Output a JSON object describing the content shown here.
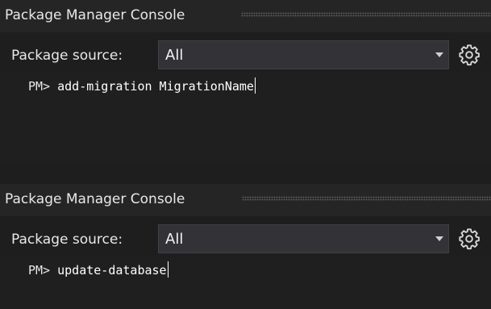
{
  "panels": [
    {
      "title": "Package Manager Console",
      "source_label": "Package source:",
      "source_value": "All",
      "prompt": "PM>",
      "command": "add-migration MigrationName"
    },
    {
      "title": "Package Manager Console",
      "source_label": "Package source:",
      "source_value": "All",
      "prompt": "PM>",
      "command": "update-database"
    }
  ],
  "icons": {
    "dropdown": "chevron-down-icon",
    "settings": "gear-icon"
  },
  "colors": {
    "background": "#1e1e1e",
    "titlebar": "#252526",
    "dropdown_bg": "#333337",
    "text": "#e8e8e8"
  }
}
